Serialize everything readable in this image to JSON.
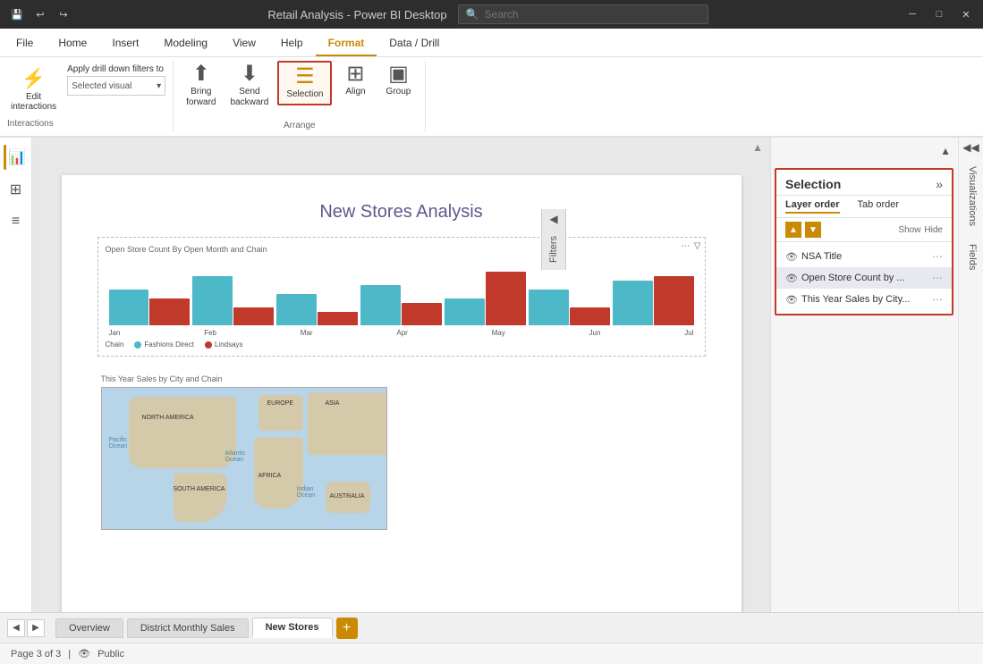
{
  "titlebar": {
    "title": "Retail Analysis - Power BI Desktop",
    "search_placeholder": "Search"
  },
  "ribbon_tabs": [
    {
      "label": "File",
      "active": false
    },
    {
      "label": "Home",
      "active": false
    },
    {
      "label": "Insert",
      "active": false
    },
    {
      "label": "Modeling",
      "active": false
    },
    {
      "label": "View",
      "active": false
    },
    {
      "label": "Help",
      "active": false
    },
    {
      "label": "Format",
      "active": true
    },
    {
      "label": "Data / Drill",
      "active": false
    }
  ],
  "ribbon": {
    "interactions_label": "Interactions",
    "edit_interactions_label": "Edit\ninteractions",
    "apply_drill_label": "Apply drill down filters to",
    "selected_visual_placeholder": "Selected visual",
    "arrange_label": "Arrange",
    "bring_forward_label": "Bring\nforward",
    "send_backward_label": "Send\nbackward",
    "selection_label": "Selection",
    "align_label": "Align",
    "group_label": "Group"
  },
  "report": {
    "title": "New Stores Analysis",
    "chart_title": "Open Store Count By Open Month and Chain",
    "map_title": "This Year Sales by City and Chain",
    "map_labels": [
      "NORTH AMERICA",
      "EUROPE",
      "ASIA",
      "SOUTH AMERICA",
      "AFRICA",
      "AUSTRALIA",
      "Pacific\nOcean",
      "Atlantic\nOcean",
      "Indian\nOcean"
    ],
    "legend": [
      "Chain",
      "Fashions Direct",
      "Lindsays"
    ]
  },
  "selection_panel": {
    "title": "Selection",
    "tab_layer": "Layer order",
    "tab_tab": "Tab order",
    "show_label": "Show",
    "hide_label": "Hide",
    "items": [
      {
        "label": "NSA Title",
        "active": false
      },
      {
        "label": "Open Store Count by ...",
        "active": true
      },
      {
        "label": "This Year Sales by City...",
        "active": false
      }
    ]
  },
  "right_panels": {
    "filters_label": "Filters",
    "visualizations_label": "Visualizations",
    "fields_label": "Fields"
  },
  "bottom_tabs": [
    {
      "label": "Overview",
      "active": false
    },
    {
      "label": "District Monthly Sales",
      "active": false
    },
    {
      "label": "New Stores",
      "active": true
    }
  ],
  "status_bar": {
    "page_info": "Page 3 of 3",
    "visibility_label": "Public"
  },
  "bar_data": [
    {
      "blue": 40,
      "red": 30
    },
    {
      "blue": 55,
      "red": 20
    },
    {
      "blue": 35,
      "red": 15
    },
    {
      "blue": 45,
      "red": 25
    },
    {
      "blue": 30,
      "red": 60
    },
    {
      "blue": 40,
      "red": 20
    },
    {
      "blue": 50,
      "red": 55
    }
  ]
}
